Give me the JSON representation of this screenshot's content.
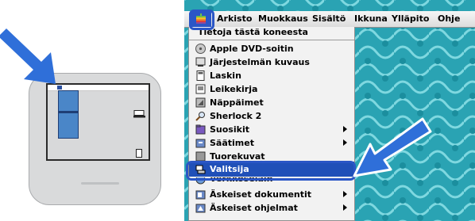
{
  "menubar": {
    "items": [
      "Arkisto",
      "Muokkaus",
      "Sisältö",
      "Ikkuna",
      "Ylläpito",
      "Ohje"
    ]
  },
  "apple_menu": {
    "header": "Tietoja tästä koneesta",
    "items": [
      {
        "label": "Apple DVD-soitin",
        "icon": "dvd-icon",
        "submenu": false
      },
      {
        "label": "Järjestelmän kuvaus",
        "icon": "system-profiler-icon",
        "submenu": false
      },
      {
        "label": "Laskin",
        "icon": "calculator-icon",
        "submenu": false
      },
      {
        "label": "Leikekirja",
        "icon": "scrapbook-icon",
        "submenu": false
      },
      {
        "label": "Näppäimet",
        "icon": "keycaps-icon",
        "submenu": false
      },
      {
        "label": "Sherlock 2",
        "icon": "sherlock-icon",
        "submenu": false
      },
      {
        "label": "Suosikit",
        "icon": "favorites-icon",
        "submenu": true
      },
      {
        "label": "Säätimet",
        "icon": "control-panels-icon",
        "submenu": true
      },
      {
        "label": "Tuorekuvat",
        "icon": "clipped-icon",
        "submenu": false
      },
      {
        "label": "Valitsija",
        "icon": "chooser-icon",
        "submenu": false,
        "selected": true
      },
      {
        "label": "Verkkoselain",
        "icon": "browser-icon",
        "submenu": false
      },
      {
        "label": "Äskeiset dokumentit",
        "icon": "recent-docs-icon",
        "submenu": true
      },
      {
        "label": "Äskeiset ohjelmat",
        "icon": "recent-apps-icon",
        "submenu": true
      }
    ]
  },
  "colors": {
    "accent": "#2a56c6",
    "selection": "#2050b8",
    "arrow": "#2f6fd9",
    "desktop": "#2ea7b6"
  }
}
